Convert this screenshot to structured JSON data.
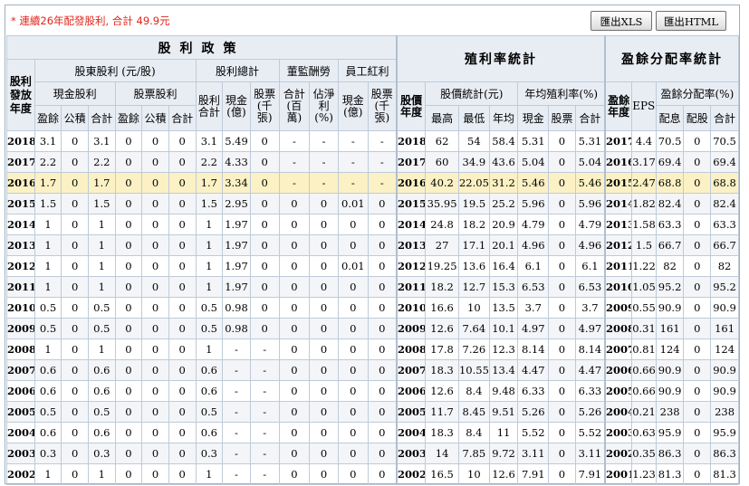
{
  "summary": "* 連續26年配發股利, 合計 49.9元",
  "buttons": {
    "xls": "匯出XLS",
    "html": "匯出HTML"
  },
  "headers": {
    "policy_title": "股利政策",
    "shareholder_dividend": "股東股利 (元/股)",
    "dividend_total": "股利總計",
    "supervisor_pay": "董監酬勞",
    "employee_bonus": "員工紅利",
    "yield_title": "殖利率統計",
    "payout_title": "盈餘分配率統計",
    "dividend_year": "股利發放年度",
    "cash_dividend": "現金股利",
    "stock_dividend": "股票股利",
    "dividend_sum": "股利合計",
    "cash_100m": "現金(億)",
    "stock_k": "股票(千張)",
    "sup_total": "合計(百萬)",
    "est_net_ratio": "佔淨利(%)",
    "emp_cash": "現金(億)",
    "emp_stock": "股票(千張)",
    "price_year": "股價年度",
    "price_stats": "股價統計(元)",
    "annual_yield": "年均殖利率(%)",
    "surplus_year": "盈餘年度",
    "eps": "EPS(元)",
    "payout_ratio": "盈餘分配率(%)",
    "sub_earn": "盈餘",
    "sub_reserve": "公積",
    "sub_total": "合計",
    "high": "最高",
    "low": "最低",
    "avg": "年均",
    "cash": "現金",
    "stock": "股票",
    "total": "合計",
    "dist": "配息",
    "stock_dist": "配股"
  },
  "rows": [
    [
      "2018",
      "3.1",
      "0",
      "3.1",
      "0",
      "0",
      "0",
      "3.1",
      "5.49",
      "0",
      "-",
      "-",
      "-",
      "-",
      "2018",
      "62",
      "54",
      "58.4",
      "5.31",
      "0",
      "5.31",
      "2017",
      "4.4",
      "70.5",
      "0",
      "70.5"
    ],
    [
      "2017",
      "2.2",
      "0",
      "2.2",
      "0",
      "0",
      "0",
      "2.2",
      "4.33",
      "0",
      "-",
      "-",
      "-",
      "-",
      "2017",
      "60",
      "34.9",
      "43.6",
      "5.04",
      "0",
      "5.04",
      "2016",
      "3.17",
      "69.4",
      "0",
      "69.4"
    ],
    [
      "2016",
      "1.7",
      "0",
      "1.7",
      "0",
      "0",
      "0",
      "1.7",
      "3.34",
      "0",
      "-",
      "-",
      "-",
      "-",
      "2016",
      "40.2",
      "22.05",
      "31.2",
      "5.46",
      "0",
      "5.46",
      "2015",
      "2.47",
      "68.8",
      "0",
      "68.8"
    ],
    [
      "2015",
      "1.5",
      "0",
      "1.5",
      "0",
      "0",
      "0",
      "1.5",
      "2.95",
      "0",
      "0",
      "0",
      "0.01",
      "0",
      "2015",
      "35.95",
      "19.5",
      "25.2",
      "5.96",
      "0",
      "5.96",
      "2014",
      "1.82",
      "82.4",
      "0",
      "82.4"
    ],
    [
      "2014",
      "1",
      "0",
      "1",
      "0",
      "0",
      "0",
      "1",
      "1.97",
      "0",
      "0",
      "0",
      "0",
      "0",
      "2014",
      "24.8",
      "18.2",
      "20.9",
      "4.79",
      "0",
      "4.79",
      "2013",
      "1.58",
      "63.3",
      "0",
      "63.3"
    ],
    [
      "2013",
      "1",
      "0",
      "1",
      "0",
      "0",
      "0",
      "1",
      "1.97",
      "0",
      "0",
      "0",
      "0",
      "0",
      "2013",
      "27",
      "17.1",
      "20.1",
      "4.96",
      "0",
      "4.96",
      "2012",
      "1.5",
      "66.7",
      "0",
      "66.7"
    ],
    [
      "2012",
      "1",
      "0",
      "1",
      "0",
      "0",
      "0",
      "1",
      "1.97",
      "0",
      "0",
      "0",
      "0.01",
      "0",
      "2012",
      "19.25",
      "13.6",
      "16.4",
      "6.1",
      "0",
      "6.1",
      "2011",
      "1.22",
      "82",
      "0",
      "82"
    ],
    [
      "2011",
      "1",
      "0",
      "1",
      "0",
      "0",
      "0",
      "1",
      "1.97",
      "0",
      "0",
      "0",
      "0",
      "0",
      "2011",
      "18.2",
      "12.7",
      "15.3",
      "6.53",
      "0",
      "6.53",
      "2010",
      "1.05",
      "95.2",
      "0",
      "95.2"
    ],
    [
      "2010",
      "0.5",
      "0",
      "0.5",
      "0",
      "0",
      "0",
      "0.5",
      "0.98",
      "0",
      "0",
      "0",
      "0",
      "0",
      "2010",
      "16.6",
      "10",
      "13.5",
      "3.7",
      "0",
      "3.7",
      "2009",
      "0.55",
      "90.9",
      "0",
      "90.9"
    ],
    [
      "2009",
      "0.5",
      "0",
      "0.5",
      "0",
      "0",
      "0",
      "0.5",
      "0.98",
      "0",
      "0",
      "0",
      "0",
      "0",
      "2009",
      "12.6",
      "7.64",
      "10.1",
      "4.97",
      "0",
      "4.97",
      "2008",
      "0.31",
      "161",
      "0",
      "161"
    ],
    [
      "2008",
      "1",
      "0",
      "1",
      "0",
      "0",
      "0",
      "1",
      "-",
      "-",
      "0",
      "0",
      "0",
      "0",
      "2008",
      "17.8",
      "7.26",
      "12.3",
      "8.14",
      "0",
      "8.14",
      "2007",
      "0.81",
      "124",
      "0",
      "124"
    ],
    [
      "2007",
      "0.6",
      "0",
      "0.6",
      "0",
      "0",
      "0",
      "0.6",
      "-",
      "-",
      "0",
      "0",
      "0",
      "0",
      "2007",
      "18.3",
      "10.55",
      "13.4",
      "4.47",
      "0",
      "4.47",
      "2006",
      "0.66",
      "90.9",
      "0",
      "90.9"
    ],
    [
      "2006",
      "0.6",
      "0",
      "0.6",
      "0",
      "0",
      "0",
      "0.6",
      "-",
      "-",
      "0",
      "0",
      "0",
      "0",
      "2006",
      "12.6",
      "8.4",
      "9.48",
      "6.33",
      "0",
      "6.33",
      "2005",
      "0.66",
      "90.9",
      "0",
      "90.9"
    ],
    [
      "2005",
      "0.5",
      "0",
      "0.5",
      "0",
      "0",
      "0",
      "0.5",
      "-",
      "-",
      "0",
      "0",
      "0",
      "0",
      "2005",
      "11.7",
      "8.45",
      "9.51",
      "5.26",
      "0",
      "5.26",
      "2004",
      "0.21",
      "238",
      "0",
      "238"
    ],
    [
      "2004",
      "0.6",
      "0",
      "0.6",
      "0",
      "0",
      "0",
      "0.6",
      "-",
      "-",
      "0",
      "0",
      "0",
      "0",
      "2004",
      "18.3",
      "8.4",
      "11",
      "5.52",
      "0",
      "5.52",
      "2003",
      "0.63",
      "95.9",
      "0",
      "95.9"
    ],
    [
      "2003",
      "0.3",
      "0",
      "0.3",
      "0",
      "0",
      "0",
      "0.3",
      "-",
      "-",
      "0",
      "0",
      "0",
      "0",
      "2003",
      "14",
      "7.85",
      "9.72",
      "3.11",
      "0",
      "3.11",
      "2002",
      "0.35",
      "86.3",
      "0",
      "86.3"
    ],
    [
      "2002",
      "1",
      "0",
      "1",
      "0",
      "0",
      "0",
      "1",
      "-",
      "-",
      "0",
      "0",
      "0",
      "0",
      "2002",
      "16.5",
      "10",
      "12.6",
      "7.91",
      "0",
      "7.91",
      "2001",
      "1.23",
      "81.3",
      "0",
      "81.3"
    ]
  ],
  "highlight_row": "2016",
  "colors": {
    "summary": "#e0251b",
    "header_bg": "#e8edf4",
    "highlight": "#fbf1c4",
    "border": "#bfcbd8"
  }
}
